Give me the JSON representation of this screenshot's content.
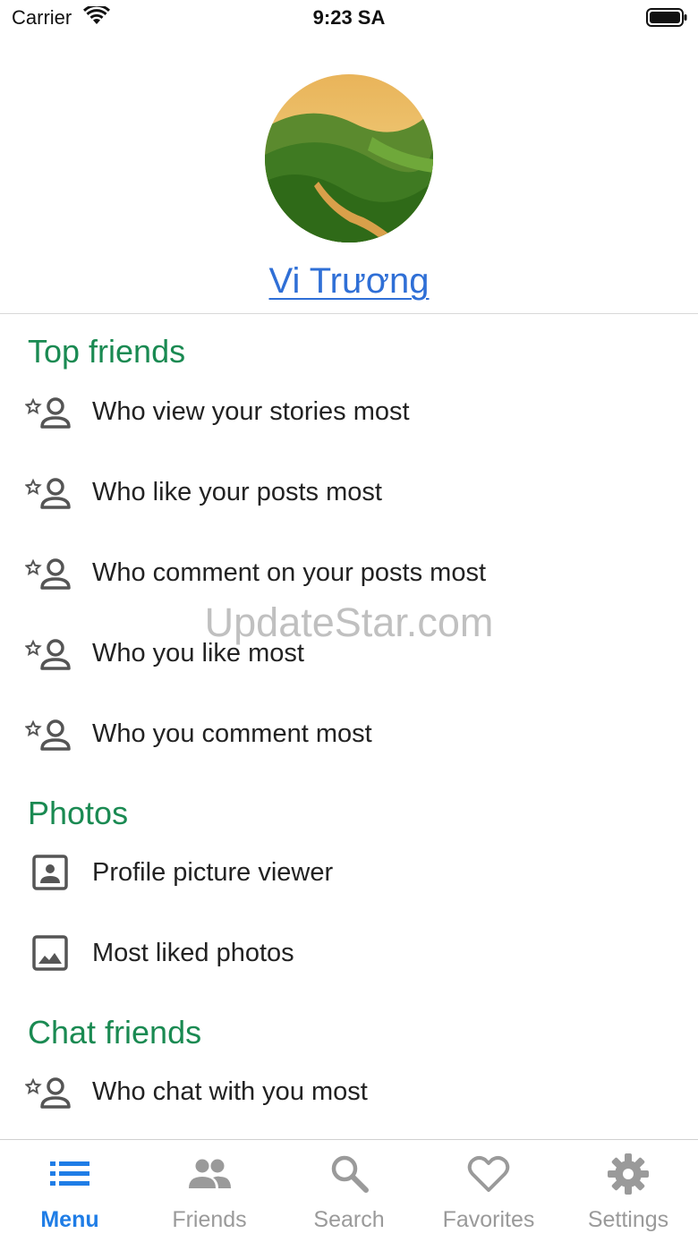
{
  "status_bar": {
    "carrier": "Carrier",
    "time": "9:23 SA"
  },
  "profile": {
    "name": "Vi Trương"
  },
  "watermark": "UpdateStar.com",
  "sections": {
    "top_friends": {
      "title": "Top friends",
      "items": [
        {
          "label": "Who view your stories most",
          "icon": "star-person-icon"
        },
        {
          "label": "Who like your posts most",
          "icon": "star-person-icon"
        },
        {
          "label": "Who comment on your posts most",
          "icon": "star-person-icon"
        },
        {
          "label": "Who you like most",
          "icon": "star-person-icon"
        },
        {
          "label": "Who you comment most",
          "icon": "star-person-icon"
        }
      ]
    },
    "photos": {
      "title": "Photos",
      "items": [
        {
          "label": "Profile picture viewer",
          "icon": "portrait-icon"
        },
        {
          "label": "Most liked photos",
          "icon": "image-icon"
        }
      ]
    },
    "chat_friends": {
      "title": "Chat friends",
      "items": [
        {
          "label": "Who chat with you most",
          "icon": "star-person-icon"
        }
      ]
    }
  },
  "tab_bar": {
    "active": "Menu",
    "tabs": [
      {
        "label": "Menu",
        "icon": "list-icon"
      },
      {
        "label": "Friends",
        "icon": "people-icon"
      },
      {
        "label": "Search",
        "icon": "search-icon"
      },
      {
        "label": "Favorites",
        "icon": "heart-icon"
      },
      {
        "label": "Settings",
        "icon": "gear-icon"
      }
    ]
  },
  "colors": {
    "accent": "#1f7de6",
    "section": "#1a8a52",
    "link": "#2f6fd6",
    "inactive": "#9a9a9a"
  }
}
